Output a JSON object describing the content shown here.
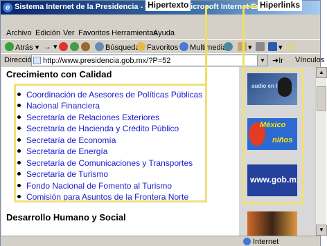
{
  "window": {
    "title": "Sistema Internet de la Presidencia - Gabinete - Microsoft Internet Explorer"
  },
  "menubar": [
    "Archivo",
    "Edición",
    "Ver",
    "Favoritos",
    "Herramientas",
    "Ayuda"
  ],
  "toolbar": {
    "back": "Atrás",
    "search": "Búsqueda",
    "favorites": "Favoritos",
    "multimedia": "Multimedia"
  },
  "address": {
    "label": "Dirección",
    "url": "http://www.presidencia.gob.mx/?P=52",
    "go": "Ir",
    "links": "Vínculos"
  },
  "content": {
    "section1_title": "Crecimiento con Calidad",
    "links": [
      "Coordinación de Asesores de Políticas Públicas",
      "Nacional Financiera",
      "Secretaría de Relaciones Exteriores",
      "Secretaría de Hacienda y Crédito Público",
      "Secretaría de Economía",
      "Secretaría de Energía",
      "Secretaría de Comunicaciones y Transportes",
      "Secretaría de Turismo",
      "Fondo Nacional de Fomento al Turismo",
      "Comisión para Asuntos de la Frontera Norte"
    ],
    "section2_title": "Desarrollo Humano y Social"
  },
  "banners": {
    "audio": "audio en línea",
    "mexico_word": "México",
    "kids_word": "niños",
    "gob": "www.gob.mx"
  },
  "statusbar": {
    "zone": "Internet"
  },
  "annotations": {
    "hipertexto": "Hipertexto",
    "hiperlinks": "Hiperlinks"
  },
  "colors": {
    "link": "#1a1ad0",
    "highlight": "#efe07b",
    "titlebar": "#0a246a"
  }
}
